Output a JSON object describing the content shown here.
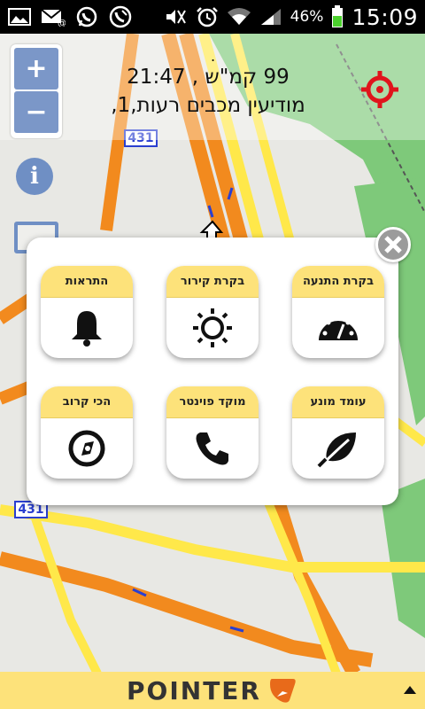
{
  "status_bar": {
    "battery_percent": "46%",
    "time": "15:09",
    "left_icons": [
      "gallery-icon",
      "missed-email-icon",
      "whatsapp-icon",
      "call-icon"
    ],
    "right_icons": [
      "mute-icon",
      "alarm-icon",
      "wifi-icon",
      "signal-icon",
      "battery-icon"
    ]
  },
  "map_info": {
    "top_line": ".",
    "speed_time": "99 קמ\"ש , 21:47",
    "address": "מודיעין מכבים רעות,1,"
  },
  "map": {
    "road_label_1": "431",
    "road_label_2": "431"
  },
  "zoom": {
    "plus": "+",
    "minus": "−"
  },
  "info_button_glyph": "i",
  "popup": {
    "tiles": [
      {
        "label": "התראות",
        "icon": "bell-icon"
      },
      {
        "label": "בקרת קירור",
        "icon": "sun-icon"
      },
      {
        "label": "בקרת התנעה",
        "icon": "speedometer-icon"
      },
      {
        "label": "הכי קרוב",
        "icon": "compass-icon"
      },
      {
        "label": "מוקד פוינטר",
        "icon": "phone-icon"
      },
      {
        "label": "עומד מונע",
        "icon": "leaf-icon"
      }
    ]
  },
  "bottom_bar": {
    "brand": "POINTER"
  },
  "colors": {
    "accent_yellow": "#fde27a",
    "road_orange": "#f28a1e",
    "road_yellow": "#ffe84a",
    "map_blue_button": "#7b97c8",
    "target_red": "#e0141c"
  }
}
